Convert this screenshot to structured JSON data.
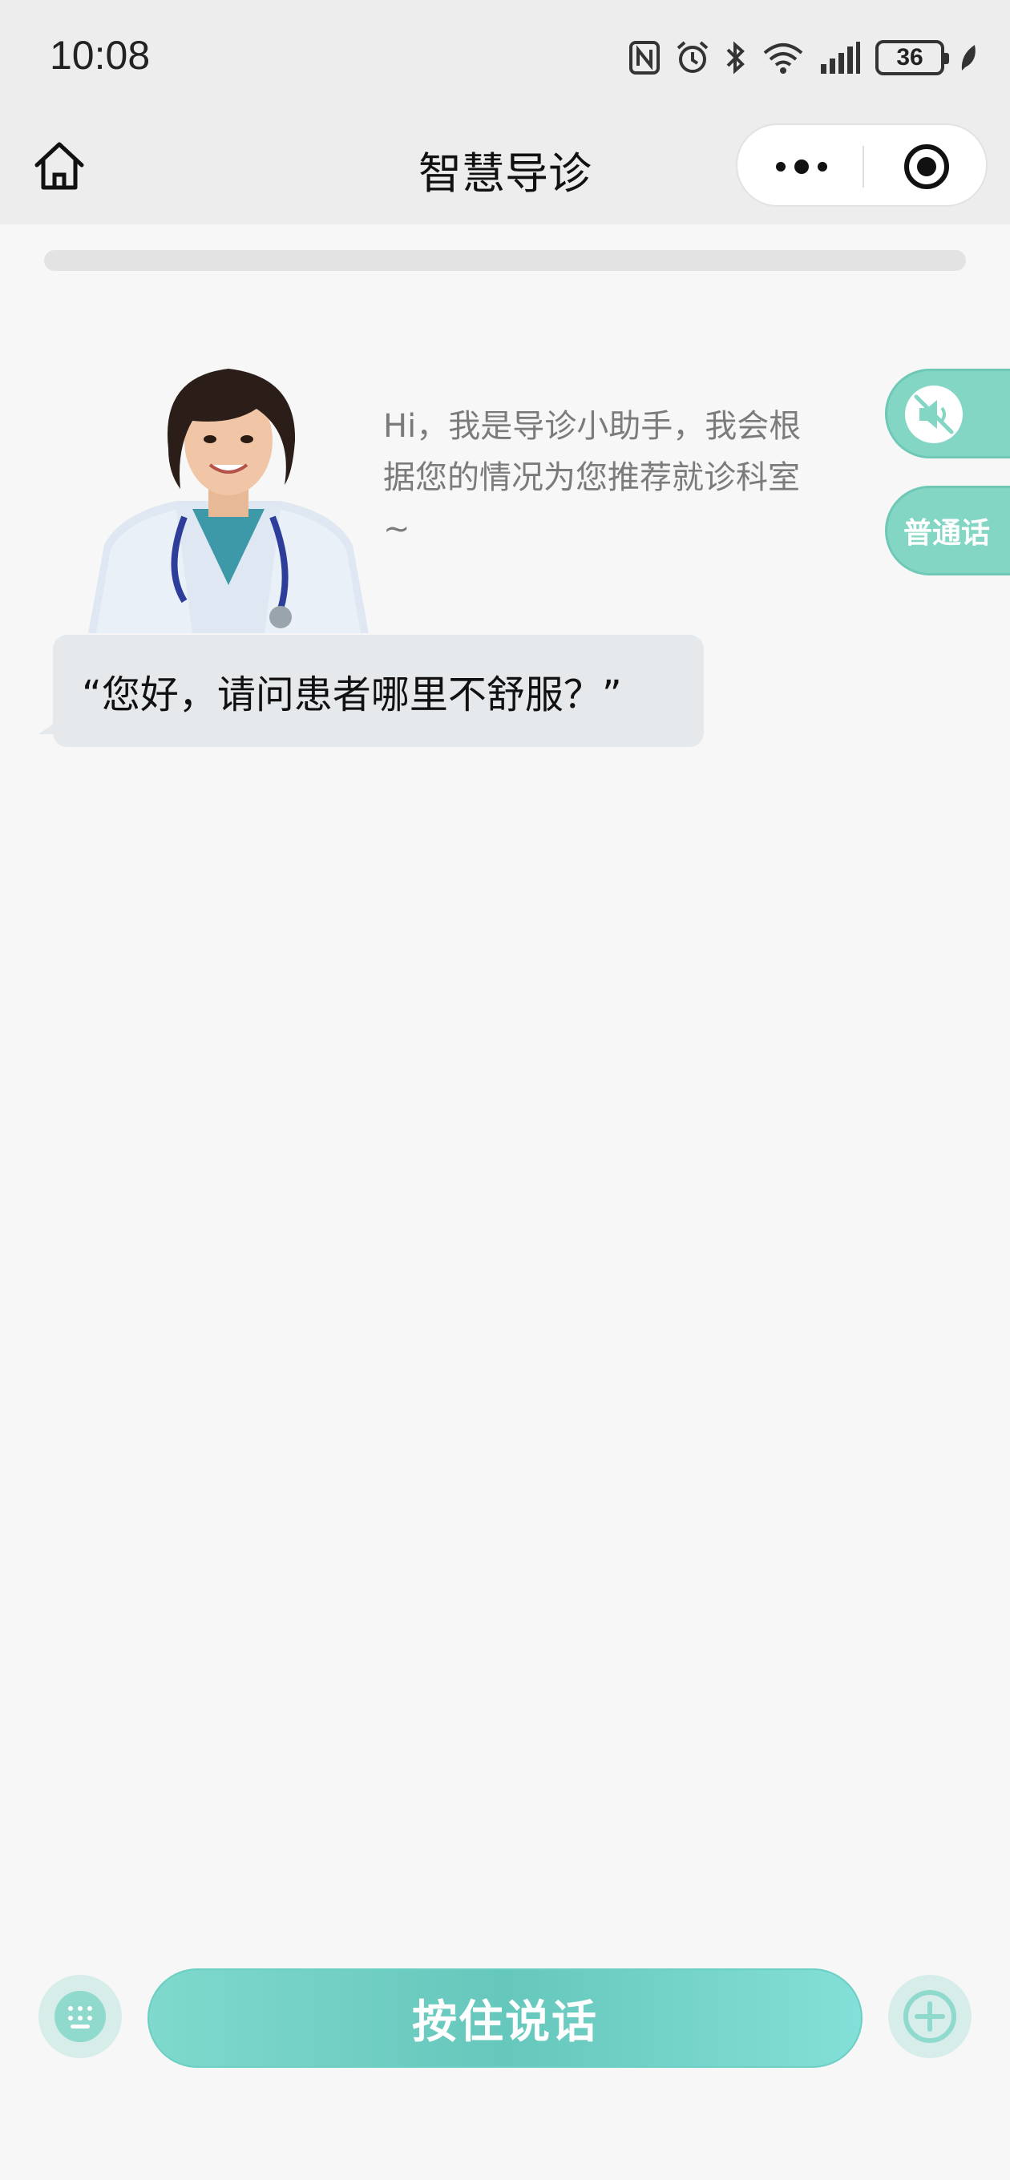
{
  "status_bar": {
    "time": "10:08",
    "icons": [
      "nfc-icon",
      "alarm-icon",
      "bluetooth-icon",
      "wifi-icon",
      "signal-icon"
    ],
    "battery": "36"
  },
  "nav": {
    "title": "智慧导诊"
  },
  "progress": {
    "fraction": 0.0
  },
  "assistant": {
    "intro": "Hi，我是导诊小助手，我会根据您的情况为您推荐就诊科室 ~",
    "greeting": "“您好，请问患者哪里不舒服？”"
  },
  "side_buttons": {
    "mute_icon": "speaker-mute-icon",
    "language": "普通话"
  },
  "bottom_bar": {
    "talk": "按住说话",
    "left_icon": "keyboard-icon",
    "right_icon": "plus-icon"
  },
  "colors": {
    "accent": "#7fd8cf",
    "bubble": "#e6e9ec",
    "background": "#f7f7f7"
  }
}
